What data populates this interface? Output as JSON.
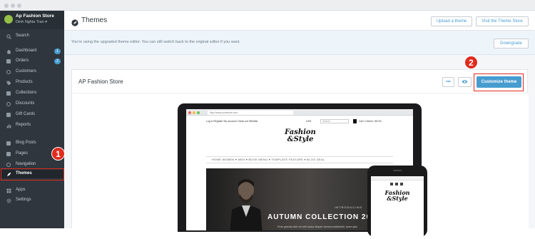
{
  "store": {
    "name": "Ap Fashion Store",
    "user": "Dinh Nghia Tran"
  },
  "sidebar": {
    "items": [
      {
        "label": "Search",
        "icon": "search-icon"
      },
      {
        "label": "Dashboard",
        "icon": "home-icon",
        "badge": "1"
      },
      {
        "label": "Orders",
        "icon": "orders-icon",
        "badge": "2"
      },
      {
        "label": "Customers",
        "icon": "customers-icon"
      },
      {
        "label": "Products",
        "icon": "tag-icon"
      },
      {
        "label": "Collections",
        "icon": "collections-icon"
      },
      {
        "label": "Discounts",
        "icon": "discount-icon"
      },
      {
        "label": "Gift Cards",
        "icon": "gift-card-icon"
      },
      {
        "label": "Reports",
        "icon": "reports-icon"
      },
      {
        "label": "Blog Posts",
        "icon": "blog-icon"
      },
      {
        "label": "Pages",
        "icon": "pages-icon"
      },
      {
        "label": "Navigation",
        "icon": "navigation-icon"
      },
      {
        "label": "Themes",
        "icon": "themes-icon",
        "active": true
      },
      {
        "label": "Apps",
        "icon": "apps-icon"
      },
      {
        "label": "Settings",
        "icon": "gear-icon"
      }
    ]
  },
  "header": {
    "title": "Themes",
    "upload_label": "Upload a theme",
    "store_label": "Visit the Theme Store"
  },
  "notice": {
    "text": "You're using the upgraded theme editor. You can still switch back to the original editor if you want.",
    "downgrade_label": "Downgrade"
  },
  "theme_card": {
    "title": "AP Fashion Store",
    "more_label": "•••",
    "customize_label": "Customize theme"
  },
  "callouts": {
    "one": "1",
    "two": "2"
  },
  "preview": {
    "url": "http://www.yourstore.com",
    "util_left": "Log in   Register   My account   Check out   Wishlist",
    "currency": "USD",
    "search_placeholder": "Search",
    "cart": "Cart: 0 items / $0.00",
    "logo_line1": "Fashion",
    "logo_line2": "&Style",
    "menu": "HOME   WOMEN ▾   MEN ▾   BOOK MENU ▾   TEMPLATE FEATURE ▾   BLOG   DEAL",
    "hero_intro": "INTRODUCING",
    "hero_title": "AUTUMN COLLECTION 2016",
    "hero_desc": "Proin gravida nibh vel velit auctor aliquet. Aenean sollicitudin, lorem quis"
  },
  "colors": {
    "accent": "#479ccf",
    "sidebar": "#2f363d",
    "highlight": "#e02b1e"
  }
}
